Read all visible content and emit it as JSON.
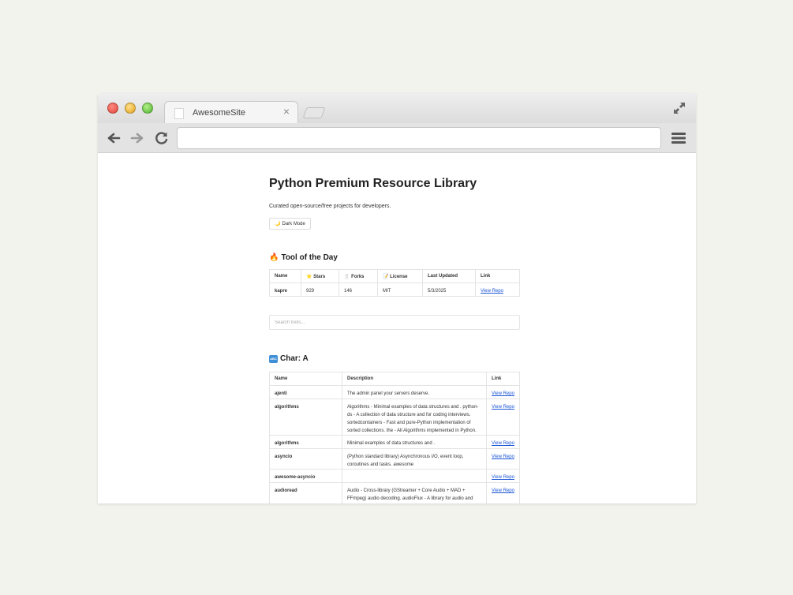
{
  "browser": {
    "tab_title": "AwesomeSite",
    "tab_close": "×",
    "address": ""
  },
  "page": {
    "title": "Python Premium Resource Library",
    "subtitle": "Curated open-source/free projects for developers.",
    "dark_mode_label": "Dark Mode",
    "dark_mode_icon": "🌙",
    "search_placeholder": "Search tools..."
  },
  "tool_of_day": {
    "icon": "🔥",
    "heading": "Tool of the Day",
    "headers": [
      {
        "icon": "",
        "label": "Name"
      },
      {
        "icon": "⭐",
        "label": "Stars"
      },
      {
        "icon": "🍴",
        "label": "Forks"
      },
      {
        "icon": "📝",
        "label": "License"
      },
      {
        "icon": "",
        "label": "Last Updated"
      },
      {
        "icon": "",
        "label": "Link"
      }
    ],
    "row": {
      "name": "kapre",
      "stars": "929",
      "forks": "146",
      "license": "MIT",
      "updated": "5/3/2025",
      "link": "View Repo"
    }
  },
  "char_section": {
    "icon_text": "ABC",
    "heading": "Char: A",
    "headers": [
      "Name",
      "Description",
      "Link"
    ],
    "rows": [
      {
        "name": "ajenti",
        "desc": "The admin panel your servers deserve.",
        "link": "View Repo"
      },
      {
        "name": "algorithms",
        "desc": "Algorithms - Minimal examples of data structures and . python-ds - A collection of data structure and for coding interviews. sortedcontainers - Fast and pure-Python implementation of sorted collections. the - All Algorithms implemented in Python.",
        "link": "View Repo"
      },
      {
        "name": "algorithms",
        "desc": "Minimal examples of data structures and .",
        "link": "View Repo"
      },
      {
        "name": "asyncio",
        "desc": "(Python standard library) Asynchronous I/O, event loop, coroutines and tasks. awesome",
        "link": "View Repo"
      },
      {
        "name": "awesome-asyncio",
        "desc": "",
        "link": "View Repo"
      },
      {
        "name": "audioread",
        "desc": "Audio - Cross-library (GStreamer + Core Audio + MAD + FFmpeg) audio decoding. audioFlux - A library for audio and music analysis, feature extraction. dejavu - Audio fingerprinting and recognition.",
        "link": "View Repo"
      }
    ]
  }
}
